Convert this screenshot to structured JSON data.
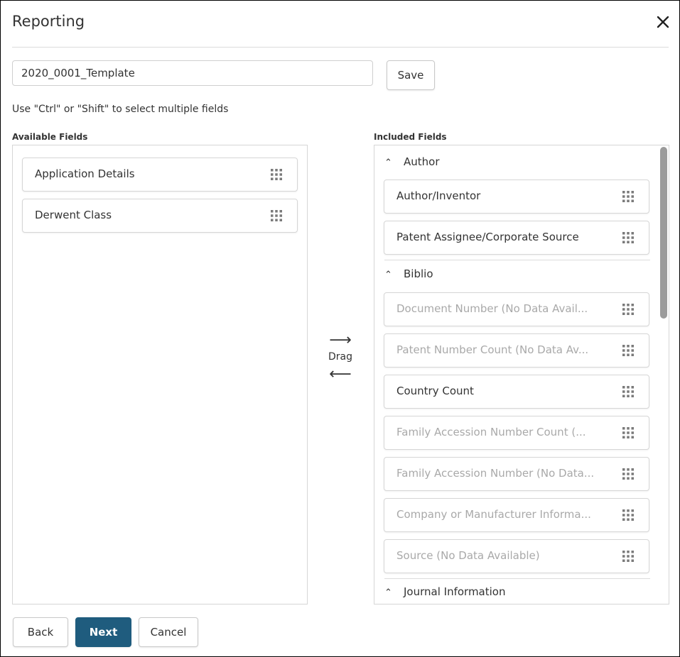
{
  "dialog": {
    "title": "Reporting",
    "template_name": "2020_0001_Template",
    "save_label": "Save",
    "hint": "Use \"Ctrl\" or \"Shift\" to select multiple fields"
  },
  "available": {
    "label": "Available Fields",
    "items": [
      {
        "label": "Application Details"
      },
      {
        "label": "Derwent Class"
      }
    ]
  },
  "drag": {
    "label": "Drag",
    "right_arrow": "⟶",
    "left_arrow": "⟵"
  },
  "included": {
    "label": "Included Fields",
    "groups": [
      {
        "name": "Author",
        "items": [
          {
            "label": "Author/Inventor",
            "disabled": false
          },
          {
            "label": "Patent Assignee/Corporate Source",
            "disabled": false
          }
        ]
      },
      {
        "name": "Biblio",
        "items": [
          {
            "label": "Document Number (No Data Avail...",
            "disabled": true
          },
          {
            "label": "Patent Number Count (No Data Av...",
            "disabled": true
          },
          {
            "label": "Country Count",
            "disabled": false
          },
          {
            "label": "Family Accession Number Count (...",
            "disabled": true
          },
          {
            "label": "Family Accession Number (No Data...",
            "disabled": true
          },
          {
            "label": "Company or Manufacturer Informa...",
            "disabled": true
          },
          {
            "label": "Source (No Data Available)",
            "disabled": true
          }
        ]
      },
      {
        "name": "Journal Information",
        "items": []
      }
    ]
  },
  "footer": {
    "back_label": "Back",
    "next_label": "Next",
    "cancel_label": "Cancel"
  },
  "colors": {
    "primary": "#1f5c7e",
    "disabled_text": "#a9a9a9",
    "border": "#d6d6d6"
  }
}
